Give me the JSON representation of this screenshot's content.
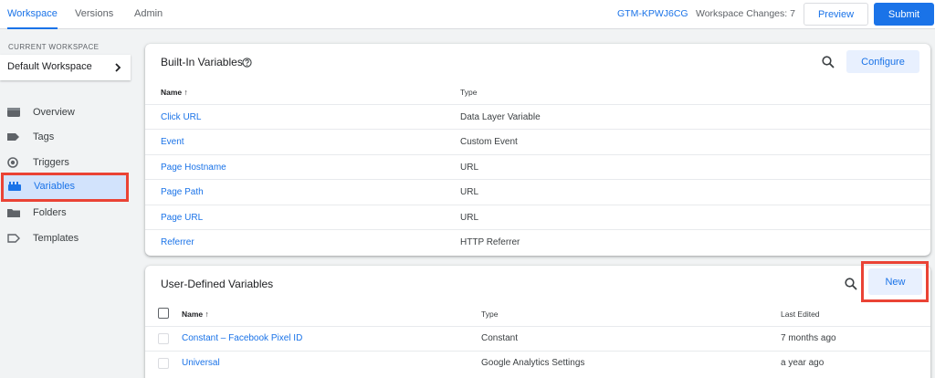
{
  "topbar": {
    "tabs": [
      {
        "label": "Workspace",
        "active": true
      },
      {
        "label": "Versions",
        "active": false
      },
      {
        "label": "Admin",
        "active": false
      }
    ],
    "container_id": "GTM-KPWJ6CG",
    "workspace_changes": "Workspace Changes: 7",
    "preview_label": "Preview",
    "submit_label": "Submit"
  },
  "sidebar": {
    "current_workspace_label": "CURRENT WORKSPACE",
    "workspace_name": "Default Workspace",
    "items": [
      {
        "label": "Overview",
        "icon": "overview-icon",
        "active": false
      },
      {
        "label": "Tags",
        "icon": "tag-icon",
        "active": false
      },
      {
        "label": "Triggers",
        "icon": "trigger-icon",
        "active": false
      },
      {
        "label": "Variables",
        "icon": "variables-icon",
        "active": true
      },
      {
        "label": "Folders",
        "icon": "folder-icon",
        "active": false
      },
      {
        "label": "Templates",
        "icon": "template-icon",
        "active": false
      }
    ]
  },
  "builtin": {
    "title": "Built-In Variables",
    "configure_label": "Configure",
    "col_name": "Name",
    "col_type": "Type",
    "rows": [
      {
        "name": "Click URL",
        "type": "Data Layer Variable"
      },
      {
        "name": "Event",
        "type": "Custom Event"
      },
      {
        "name": "Page Hostname",
        "type": "URL"
      },
      {
        "name": "Page Path",
        "type": "URL"
      },
      {
        "name": "Page URL",
        "type": "URL"
      },
      {
        "name": "Referrer",
        "type": "HTTP Referrer"
      }
    ]
  },
  "userdefined": {
    "title": "User-Defined Variables",
    "new_label": "New",
    "col_name": "Name",
    "col_type": "Type",
    "col_last_edited": "Last Edited",
    "rows": [
      {
        "name": "Constant – Facebook Pixel ID",
        "type": "Constant",
        "last_edited": "7 months ago"
      },
      {
        "name": "Universal",
        "type": "Google Analytics Settings",
        "last_edited": "a year ago"
      }
    ]
  },
  "colors": {
    "accent": "#1a73e8",
    "highlight_border": "#ea4335",
    "active_bg": "#d2e3fc"
  }
}
